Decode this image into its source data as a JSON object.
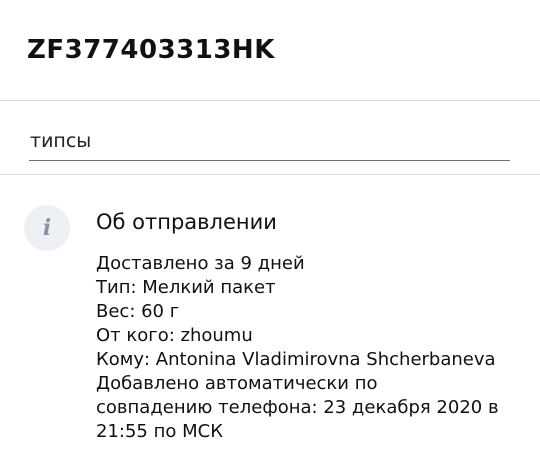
{
  "header": {
    "tracking_number": "ZF377403313HK"
  },
  "note": {
    "value": "типсы",
    "placeholder": ""
  },
  "info": {
    "icon": "info-icon",
    "icon_glyph": "i",
    "title": "Об отправлении",
    "lines": [
      "Доставлено за 9 дней",
      "Тип: Мелкий пакет",
      "Вес: 60 г",
      "От кого: zhoumu",
      "Кому: Antonina Vladimirovna Shcherbaneva",
      "Добавлено автоматически по",
      "совпадению телефона: 23 декабря 2020 в",
      "21:55 по МСК"
    ]
  }
}
